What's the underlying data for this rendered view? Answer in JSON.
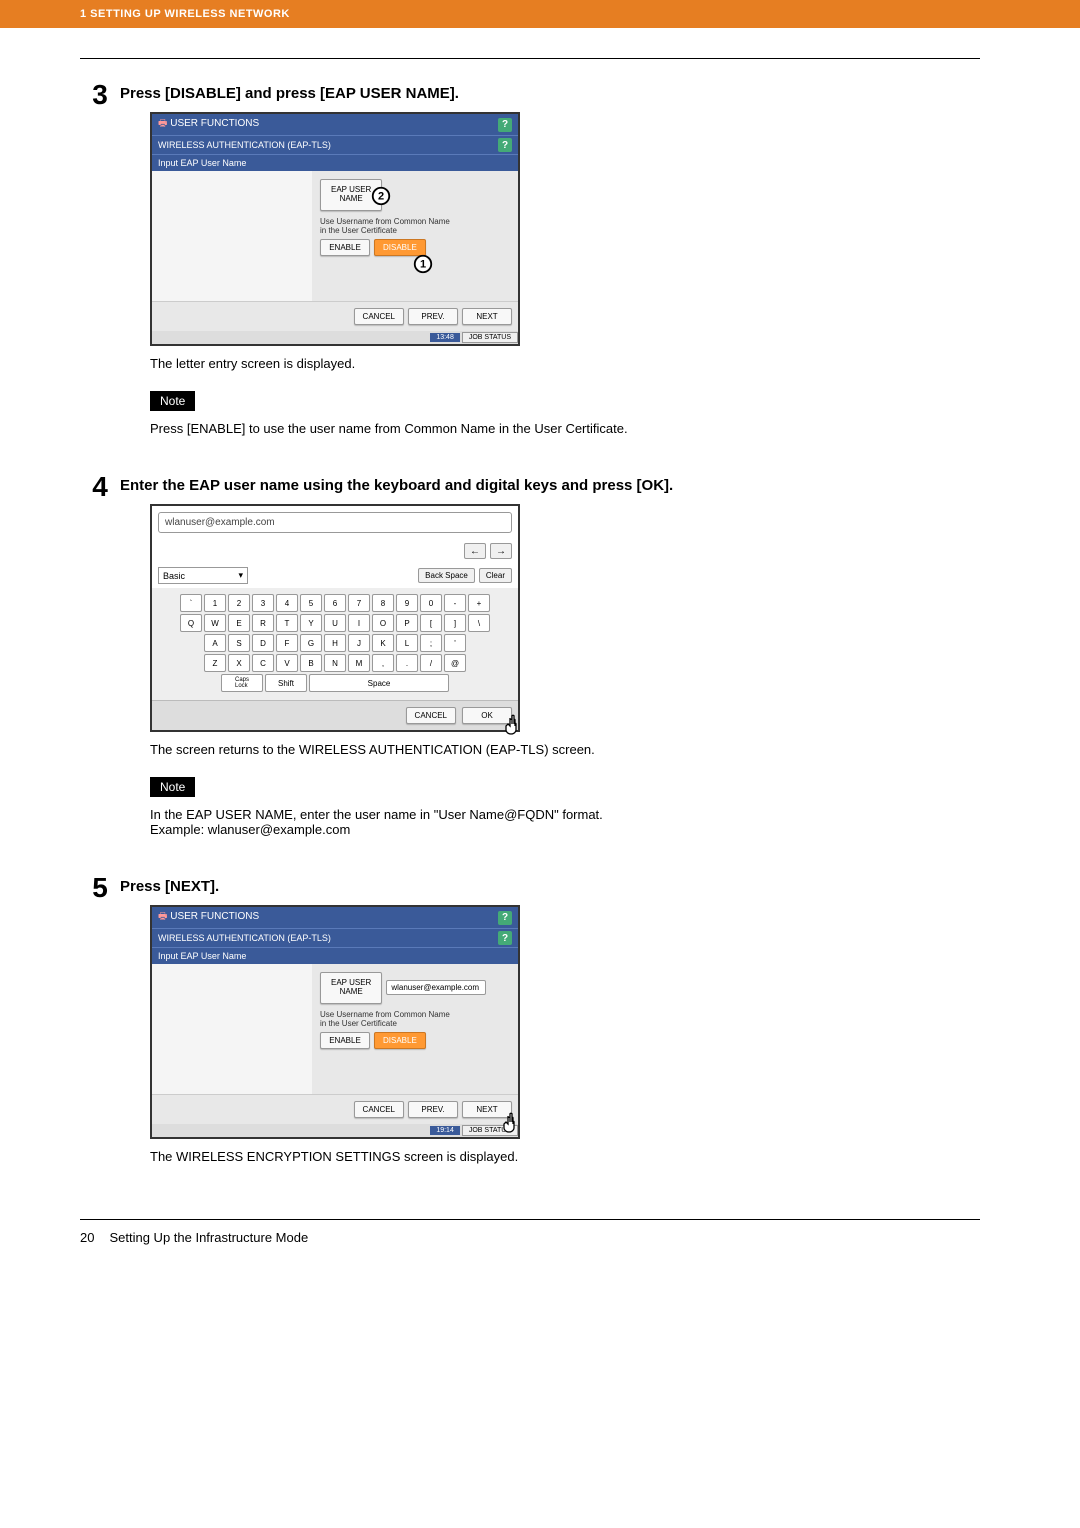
{
  "header": {
    "chapter": "1 SETTING UP WIRELESS NETWORK"
  },
  "step3": {
    "num": "3",
    "title": "Press [DISABLE] and press [EAP USER NAME].",
    "post_text": "The letter entry screen is displayed.",
    "note_label": "Note",
    "note_text": "Press [ENABLE] to use the user name from Common Name in the User Certificate.",
    "ss": {
      "title": "USER FUNCTIONS",
      "subtitle": "WIRELESS AUTHENTICATION (EAP-TLS)",
      "breadcrumb": "Input EAP User Name",
      "eap_btn": "EAP USER\nNAME",
      "common_text": "Use Username from Common Name\nin the User Certificate",
      "enable": "ENABLE",
      "disable": "DISABLE",
      "cancel": "CANCEL",
      "prev": "PREV.",
      "next": "NEXT",
      "time": "13:48",
      "jobstatus": "JOB STATUS",
      "pointer1": "1",
      "pointer2": "2"
    }
  },
  "step4": {
    "num": "4",
    "title": "Enter the EAP user name using the keyboard and digital keys and press [OK].",
    "post_text": "The screen returns to the WIRELESS AUTHENTICATION (EAP-TLS) screen.",
    "note_label": "Note",
    "note_text1": "In the EAP USER NAME, enter the user name in \"User Name@FQDN\" format.",
    "note_text2": "Example: wlanuser@example.com",
    "kb": {
      "input": "wlanuser@example.com",
      "mode": "Basic",
      "backspace": "Back Space",
      "clear": "Clear",
      "capslock": "Caps\nLock",
      "shift": "Shift",
      "space": "Space",
      "cancel": "CANCEL",
      "ok": "OK",
      "row_num": [
        "`",
        "1",
        "2",
        "3",
        "4",
        "5",
        "6",
        "7",
        "8",
        "9",
        "0",
        "-",
        "+"
      ],
      "row_q": [
        "Q",
        "W",
        "E",
        "R",
        "T",
        "Y",
        "U",
        "I",
        "O",
        "P",
        "[",
        "]",
        "\\"
      ],
      "row_a": [
        "A",
        "S",
        "D",
        "F",
        "G",
        "H",
        "J",
        "K",
        "L",
        ";",
        "'"
      ],
      "row_z": [
        "Z",
        "X",
        "C",
        "V",
        "B",
        "N",
        "M",
        ",",
        ".",
        "/",
        "@"
      ]
    }
  },
  "step5": {
    "num": "5",
    "title": "Press [NEXT].",
    "post_text": "The WIRELESS ENCRYPTION SETTINGS screen is displayed.",
    "ss": {
      "title": "USER FUNCTIONS",
      "subtitle": "WIRELESS AUTHENTICATION (EAP-TLS)",
      "breadcrumb": "Input EAP User Name",
      "eap_btn": "EAP USER\nNAME",
      "eap_val": "wlanuser@example.com",
      "common_text": "Use Username from Common Name\nin the User Certificate",
      "enable": "ENABLE",
      "disable": "DISABLE",
      "cancel": "CANCEL",
      "prev": "PREV.",
      "next": "NEXT",
      "time": "19:14",
      "jobstatus": "JOB STATUS"
    }
  },
  "footer": {
    "page": "20",
    "title": "Setting Up the Infrastructure Mode"
  }
}
